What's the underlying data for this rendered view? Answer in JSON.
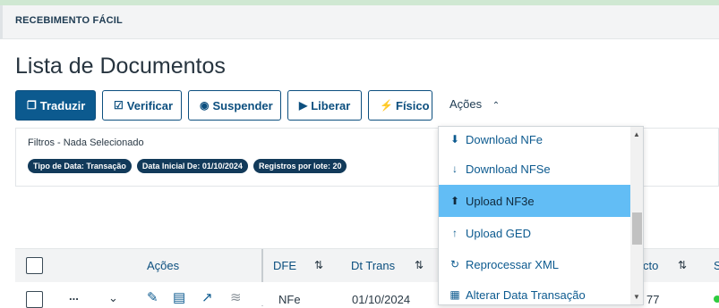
{
  "header": {
    "title": "RECEBIMENTO FÁCIL"
  },
  "page": {
    "title": "Lista de Documentos"
  },
  "toolbar": {
    "buttons": [
      {
        "label": "Traduzir",
        "icon": "copy-icon"
      },
      {
        "label": "Verificar",
        "icon": "check-square-icon"
      },
      {
        "label": "Suspender",
        "icon": "stop-circle-icon"
      },
      {
        "label": "Liberar",
        "icon": "play-circle-icon"
      },
      {
        "label": "Físico",
        "icon": "bolt-icon"
      }
    ],
    "acoes_label": "Ações"
  },
  "filters": {
    "title": "Filtros - Nada Selecionado",
    "chips": [
      "Tipo de Data: Transação",
      "Data Inicial De: 01/10/2024",
      "Registros por lote: 20"
    ]
  },
  "table": {
    "columns": [
      "Ações",
      "DFE",
      "Dt Trans",
      "cto",
      "S"
    ],
    "row": {
      "dfe": "NFe",
      "dt_trans": "01/10/2024",
      "partial_value": "77",
      "more": "..."
    }
  },
  "dropdown": {
    "items": [
      {
        "label": "Download NFe",
        "icon": "file-download-icon"
      },
      {
        "label": "Download NFSe",
        "icon": "arrow-down-icon"
      },
      {
        "label": "Upload NF3e",
        "icon": "file-upload-icon",
        "highlighted": true
      },
      {
        "label": "Upload GED",
        "icon": "arrow-up-icon"
      },
      {
        "label": "Reprocessar XML",
        "icon": "refresh-icon"
      },
      {
        "label": "Alterar Data Transação",
        "icon": "calendar-icon"
      }
    ]
  },
  "colors": {
    "primary": "#0c5a8f",
    "highlight": "#62bdf5",
    "chip": "#123a5a"
  }
}
